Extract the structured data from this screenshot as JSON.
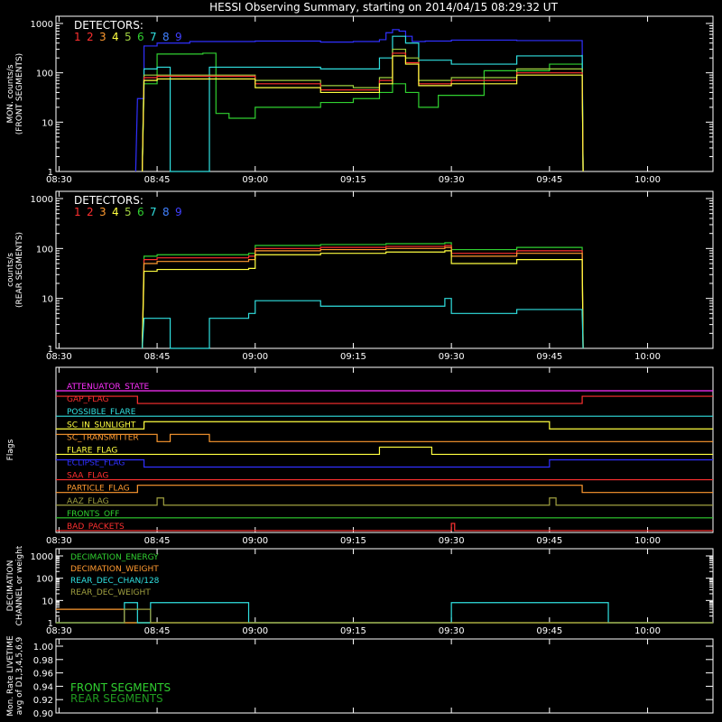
{
  "title": "HESSI Observing Summary, starting on 2014/04/15 08:29:32 UT",
  "time_ticks": [
    "08:30",
    "08:45",
    "09:00",
    "09:15",
    "09:30",
    "09:45",
    "10:00"
  ],
  "detector_colors": [
    "#ff3030",
    "#ff3030",
    "#ff9a30",
    "#ffff40",
    "#a0d040",
    "#30d030",
    "#30e0e0",
    "#4080ff",
    "#4040ff"
  ],
  "chart_data": [
    {
      "type": "line",
      "panel": "front",
      "title": "HESSI Observing Summary, starting on 2014/04/15 08:29:32 UT",
      "ylabel": "MON. counts/s (FRONT SEGMENTS)",
      "ylabel_lines": [
        "MON. counts/s",
        "(FRONT SEGMENTS)"
      ],
      "legend_title": "DETECTORS:",
      "legend_numbers": [
        "1",
        "2",
        "3",
        "4",
        "5",
        "6",
        "7",
        "8",
        "9"
      ],
      "y_scale": "log",
      "ylim": [
        1,
        1000
      ],
      "y_tick_labels": [
        "1",
        "10",
        "100",
        "1000"
      ],
      "xlim": [
        "08:29:32",
        "10:10"
      ],
      "x_tick_labels": [
        "08:30",
        "08:45",
        "09:00",
        "09:15",
        "09:30",
        "09:45",
        "10:00"
      ],
      "series": [
        {
          "name": "9",
          "color": "#3030ff",
          "x": [
            "08:42",
            "08:43",
            "08:45",
            "08:50",
            "09:00",
            "09:10",
            "09:15",
            "09:19",
            "09:20",
            "09:21",
            "09:22",
            "09:23",
            "09:24",
            "09:26",
            "09:30",
            "09:40",
            "09:50"
          ],
          "values": [
            30,
            350,
            400,
            430,
            440,
            420,
            430,
            470,
            650,
            750,
            700,
            550,
            430,
            440,
            460,
            450,
            440
          ]
        },
        {
          "name": "6",
          "color": "#30d030",
          "x": [
            "08:43",
            "08:45",
            "08:52",
            "08:54",
            "08:56",
            "09:00",
            "09:10",
            "09:15",
            "09:19",
            "09:21",
            "09:23",
            "09:25",
            "09:28",
            "09:35",
            "09:45",
            "09:50"
          ],
          "values": [
            60,
            240,
            250,
            15,
            12,
            20,
            25,
            30,
            40,
            60,
            40,
            20,
            35,
            110,
            150,
            160
          ]
        },
        {
          "name": "7",
          "color": "#30e0e0",
          "x": [
            "08:43",
            "08:45",
            "08:47",
            "08:48",
            "08:53",
            "08:54",
            "09:00",
            "09:10",
            "09:15",
            "09:19",
            "09:21",
            "09:23",
            "09:25",
            "09:30",
            "09:40",
            "09:50"
          ],
          "values": [
            120,
            130,
            1,
            1,
            130,
            130,
            130,
            120,
            120,
            200,
            550,
            400,
            180,
            150,
            220,
            230
          ]
        },
        {
          "name": "5",
          "color": "#a0d040",
          "x": [
            "08:43",
            "08:45",
            "09:00",
            "09:10",
            "09:15",
            "09:19",
            "09:21",
            "09:23",
            "09:25",
            "09:30",
            "09:40",
            "09:50"
          ],
          "values": [
            90,
            90,
            70,
            55,
            50,
            80,
            300,
            200,
            70,
            80,
            120,
            110
          ]
        },
        {
          "name": "1",
          "color": "#ff3030",
          "x": [
            "08:43",
            "08:45",
            "09:00",
            "09:10",
            "09:15",
            "09:19",
            "09:21",
            "09:23",
            "09:25",
            "09:30",
            "09:40",
            "09:50"
          ],
          "values": [
            80,
            85,
            60,
            45,
            45,
            70,
            250,
            160,
            60,
            70,
            100,
            95
          ]
        },
        {
          "name": "4",
          "color": "#ffff40",
          "x": [
            "08:43",
            "08:45",
            "09:00",
            "09:10",
            "09:15",
            "09:19",
            "09:21",
            "09:23",
            "09:25",
            "09:30",
            "09:40",
            "09:50"
          ],
          "values": [
            70,
            75,
            50,
            40,
            40,
            60,
            220,
            150,
            55,
            60,
            90,
            85
          ]
        }
      ]
    },
    {
      "type": "line",
      "panel": "rear",
      "ylabel": "counts/s (REAR SEGMENTS)",
      "ylabel_lines": [
        "counts/s",
        "(REAR SEGMENTS)"
      ],
      "legend_title": "DETECTORS:",
      "legend_numbers": [
        "1",
        "2",
        "3",
        "4",
        "5",
        "6",
        "7",
        "8",
        "9"
      ],
      "y_scale": "log",
      "ylim": [
        1,
        1000
      ],
      "y_tick_labels": [
        "1",
        "10",
        "100",
        "1000"
      ],
      "xlim": [
        "08:29:32",
        "10:10"
      ],
      "x_tick_labels": [
        "08:30",
        "08:45",
        "09:00",
        "09:15",
        "09:30",
        "09:45",
        "10:00"
      ],
      "series": [
        {
          "name": "6",
          "color": "#30d030",
          "x": [
            "08:43",
            "08:45",
            "08:59",
            "09:00",
            "09:10",
            "09:20",
            "09:29",
            "09:30",
            "09:40",
            "09:50"
          ],
          "values": [
            70,
            75,
            80,
            115,
            120,
            125,
            130,
            95,
            105,
            95
          ]
        },
        {
          "name": "1",
          "color": "#ff3030",
          "x": [
            "08:43",
            "08:45",
            "08:59",
            "09:00",
            "09:10",
            "09:20",
            "09:29",
            "09:30",
            "09:40",
            "09:50"
          ],
          "values": [
            60,
            65,
            70,
            100,
            105,
            110,
            115,
            80,
            90,
            85
          ]
        },
        {
          "name": "3",
          "color": "#ff9a30",
          "x": [
            "08:43",
            "08:45",
            "08:59",
            "09:00",
            "09:10",
            "09:20",
            "09:29",
            "09:30",
            "09:40",
            "09:50"
          ],
          "values": [
            50,
            55,
            60,
            90,
            95,
            100,
            105,
            70,
            80,
            75
          ]
        },
        {
          "name": "4",
          "color": "#ffff40",
          "x": [
            "08:43",
            "08:45",
            "08:59",
            "09:00",
            "09:10",
            "09:20",
            "09:29",
            "09:30",
            "09:40",
            "09:50"
          ],
          "values": [
            35,
            38,
            40,
            75,
            80,
            85,
            90,
            50,
            60,
            55
          ]
        },
        {
          "name": "7",
          "color": "#30e0e0",
          "x": [
            "08:43",
            "08:45",
            "08:47",
            "08:48",
            "08:53",
            "08:54",
            "08:59",
            "09:00",
            "09:10",
            "09:20",
            "09:29",
            "09:30",
            "09:40",
            "09:50"
          ],
          "values": [
            4,
            4,
            1,
            1,
            4,
            4,
            5,
            9,
            7,
            7,
            10,
            5,
            6,
            5
          ]
        }
      ]
    },
    {
      "type": "line",
      "panel": "flags",
      "ylabel": "Flags",
      "xlim": [
        "08:29:32",
        "10:10"
      ],
      "x_tick_labels": [
        "08:30",
        "08:45",
        "09:00",
        "09:15",
        "09:30",
        "09:45",
        "10:00"
      ],
      "series": [
        {
          "name": "ATTENUATOR_STATE",
          "color": "#ff30ff",
          "segments": [
            [
              "08:29:32",
              "10:10",
              0
            ]
          ]
        },
        {
          "name": "GAP_FLAG",
          "color": "#ff3030",
          "segments": [
            [
              "08:29:32",
              "08:42",
              1
            ],
            [
              "08:42",
              "09:50",
              0
            ],
            [
              "09:50",
              "10:10",
              1
            ]
          ]
        },
        {
          "name": "POSSIBLE_FLARE",
          "color": "#30e0e0",
          "segments": [
            [
              "08:29:32",
              "10:10",
              0
            ]
          ]
        },
        {
          "name": "SC_IN_SUNLIGHT",
          "color": "#ffff40",
          "segments": [
            [
              "08:29:32",
              "08:43",
              0
            ],
            [
              "08:43",
              "09:45",
              1
            ],
            [
              "09:45",
              "10:10",
              0
            ]
          ]
        },
        {
          "name": "SC_TRANSMITTER",
          "color": "#ff9a30",
          "segments": [
            [
              "08:29:32",
              "08:45",
              1
            ],
            [
              "08:45",
              "08:47",
              0
            ],
            [
              "08:47",
              "08:53",
              1
            ],
            [
              "08:53",
              "10:10",
              0
            ]
          ]
        },
        {
          "name": "FLARE_FLAG",
          "color": "#ffff40",
          "segments": [
            [
              "08:29:32",
              "09:19",
              0
            ],
            [
              "09:19",
              "09:27",
              1
            ],
            [
              "09:27",
              "10:10",
              0
            ]
          ]
        },
        {
          "name": "ECLIPSE_FLAG",
          "color": "#3030ff",
          "segments": [
            [
              "08:29:32",
              "08:43",
              1
            ],
            [
              "08:43",
              "09:45",
              0
            ],
            [
              "09:45",
              "10:10",
              1
            ]
          ]
        },
        {
          "name": "SAA_FLAG",
          "color": "#ff3030",
          "segments": [
            [
              "08:29:32",
              "10:10",
              0
            ]
          ]
        },
        {
          "name": "PARTICLE_FLAG",
          "color": "#ff9a30",
          "segments": [
            [
              "08:29:32",
              "08:42",
              0
            ],
            [
              "08:42",
              "09:50",
              1
            ],
            [
              "09:50",
              "10:10",
              0
            ]
          ]
        },
        {
          "name": "AAZ_FLAG",
          "color": "#a0a040",
          "segments": [
            [
              "08:29:32",
              "08:45",
              0
            ],
            [
              "08:45",
              "08:46",
              1
            ],
            [
              "08:46",
              "09:45",
              0
            ],
            [
              "09:45",
              "09:46",
              1
            ],
            [
              "09:46",
              "10:10",
              0
            ]
          ]
        },
        {
          "name": "FRONTS_OFF",
          "color": "#30d030",
          "segments": [
            [
              "08:29:32",
              "10:10",
              0
            ]
          ]
        },
        {
          "name": "BAD_PACKETS",
          "color": "#ff3030",
          "segments": [
            [
              "08:29:32",
              "09:30",
              0
            ],
            [
              "09:30",
              "09:30:30",
              1
            ],
            [
              "09:30:30",
              "10:10",
              0
            ]
          ]
        }
      ]
    },
    {
      "type": "line",
      "panel": "decimation",
      "ylabel": "DECIMATION CHANNEL or weight",
      "ylabel_lines": [
        "DECIMATION",
        "CHANNEL or weight"
      ],
      "y_scale": "log",
      "ylim": [
        1,
        1000
      ],
      "y_tick_labels": [
        "1",
        "10",
        "100",
        "1000"
      ],
      "xlim": [
        "08:29:32",
        "10:10"
      ],
      "x_tick_labels": [
        "08:30",
        "08:45",
        "09:00",
        "09:15",
        "09:30",
        "09:45",
        "10:00"
      ],
      "series": [
        {
          "name": "DECIMATION_ENERGY",
          "color": "#30d030",
          "segments": [
            [
              "08:29:32",
              "10:10",
              1
            ]
          ]
        },
        {
          "name": "DECIMATION_WEIGHT",
          "color": "#ff9a30",
          "segments": [
            [
              "08:29:32",
              "08:40",
              4
            ],
            [
              "08:40",
              "10:10",
              1
            ]
          ]
        },
        {
          "name": "REAR_DEC_CHAN/128",
          "color": "#30e0e0",
          "segments": [
            [
              "08:29:32",
              "08:40",
              1
            ],
            [
              "08:40",
              "08:42",
              8
            ],
            [
              "08:42",
              "08:44",
              1
            ],
            [
              "08:44",
              "08:59",
              8
            ],
            [
              "08:59",
              "09:30",
              1
            ],
            [
              "09:30",
              "09:54",
              8
            ],
            [
              "09:54",
              "10:10",
              1
            ]
          ]
        },
        {
          "name": "REAR_DEC_WEIGHT",
          "color": "#a0a040",
          "segments": [
            [
              "08:29:32",
              "08:40",
              1
            ],
            [
              "08:40",
              "08:44",
              4
            ],
            [
              "08:44",
              "10:10",
              1
            ]
          ]
        }
      ]
    },
    {
      "type": "line",
      "panel": "livetime",
      "ylabel": "Mon. Rate LIVETIME avg of D1,3,4,5,6,9",
      "ylabel_lines": [
        "Mon. Rate LIVETIME",
        "avg of D1,3,4,5,6,9"
      ],
      "ylim": [
        0.9,
        1.0
      ],
      "y_tick_labels": [
        "0.90",
        "0.92",
        "0.94",
        "0.96",
        "0.98",
        "1.00"
      ],
      "xlim": [
        "08:29:32",
        "10:10"
      ],
      "legend": [
        "FRONT SEGMENTS",
        "REAR SEGMENTS"
      ],
      "series": []
    }
  ]
}
